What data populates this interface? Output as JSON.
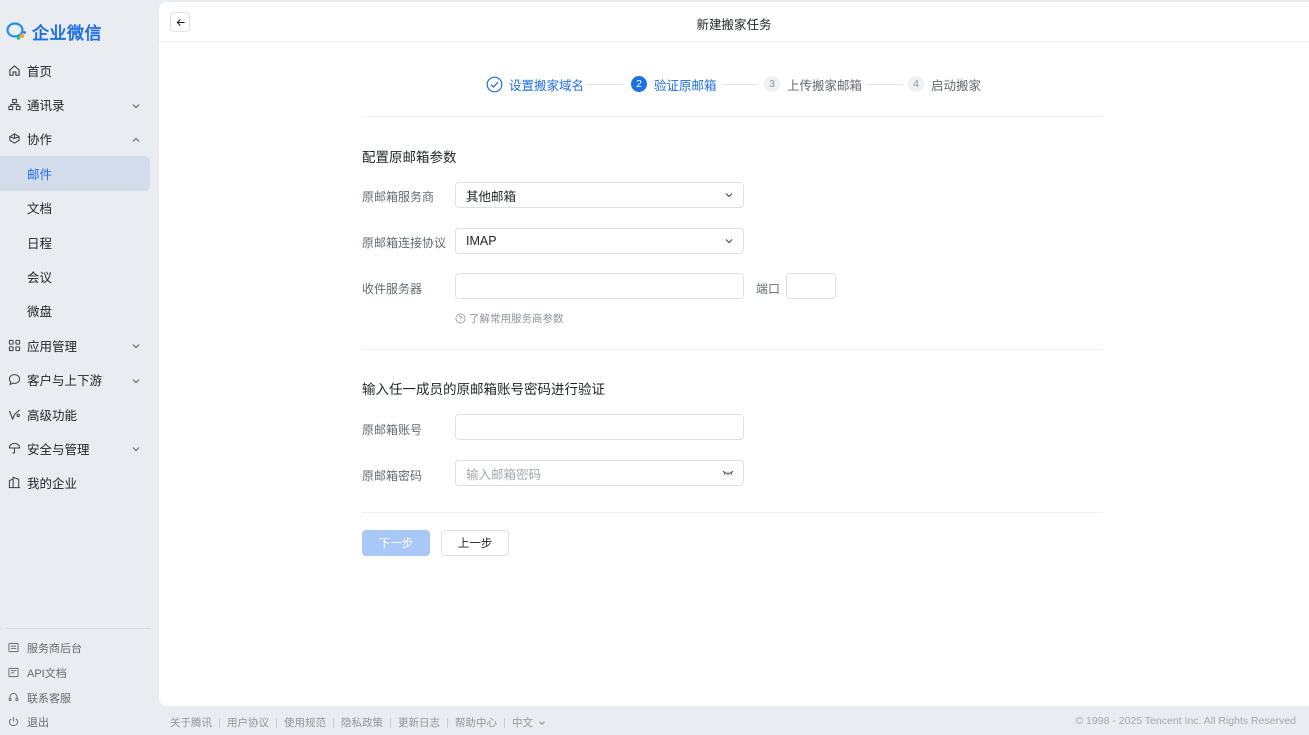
{
  "brand": {
    "name": "企业微信",
    "color": "#1f6fe5"
  },
  "sidebar": {
    "items": [
      {
        "label": "首页",
        "icon": "home-icon"
      },
      {
        "label": "通讯录",
        "icon": "org-icon",
        "chevron": "down"
      },
      {
        "label": "协作",
        "icon": "collab-icon",
        "chevron": "up"
      },
      {
        "label": "邮件",
        "sub": true,
        "active": true
      },
      {
        "label": "文档",
        "sub": true
      },
      {
        "label": "日程",
        "sub": true
      },
      {
        "label": "会议",
        "sub": true
      },
      {
        "label": "微盘",
        "sub": true
      },
      {
        "label": "应用管理",
        "icon": "apps-icon",
        "chevron": "down"
      },
      {
        "label": "客户与上下游",
        "icon": "chat-icon",
        "chevron": "down"
      },
      {
        "label": "高级功能",
        "icon": "advanced-icon"
      },
      {
        "label": "安全与管理",
        "icon": "umbrella-icon",
        "chevron": "down"
      },
      {
        "label": "我的企业",
        "icon": "building-icon"
      }
    ],
    "bottom_links": [
      {
        "label": "服务商后台",
        "icon": "service-icon"
      },
      {
        "label": "API文档",
        "icon": "doc-icon"
      },
      {
        "label": "联系客服",
        "icon": "headset-icon"
      },
      {
        "label": "退出",
        "icon": "power-icon"
      }
    ]
  },
  "header": {
    "title": "新建搬家任务"
  },
  "steps": [
    {
      "num": "1",
      "label": "设置搬家域名",
      "status": "done"
    },
    {
      "num": "2",
      "label": "验证原邮箱",
      "status": "current"
    },
    {
      "num": "3",
      "label": "上传搬家邮箱",
      "status": "todo"
    },
    {
      "num": "4",
      "label": "启动搬家",
      "status": "todo"
    }
  ],
  "config": {
    "title": "配置原邮箱参数",
    "provider_label": "原邮箱服务商",
    "provider_value": "其他邮箱",
    "protocol_label": "原邮箱连接协议",
    "protocol_value": "IMAP",
    "server_label": "收件服务器",
    "server_value": "",
    "port_label": "端口",
    "port_value": "",
    "hint": "了解常用服务商参数"
  },
  "verify": {
    "title": "输入任一成员的原邮箱账号密码进行验证",
    "account_label": "原邮箱账号",
    "account_value": "",
    "password_label": "原邮箱密码",
    "password_placeholder": "输入邮箱密码"
  },
  "buttons": {
    "next": "下一步",
    "prev": "上一步"
  },
  "footer": {
    "links": [
      "关于腾讯",
      "用户协议",
      "使用规范",
      "隐私政策",
      "更新日志",
      "帮助中心"
    ],
    "language": "中文",
    "copyright": "© 1998 - 2025 Tencent Inc. All Rights Reserved"
  }
}
